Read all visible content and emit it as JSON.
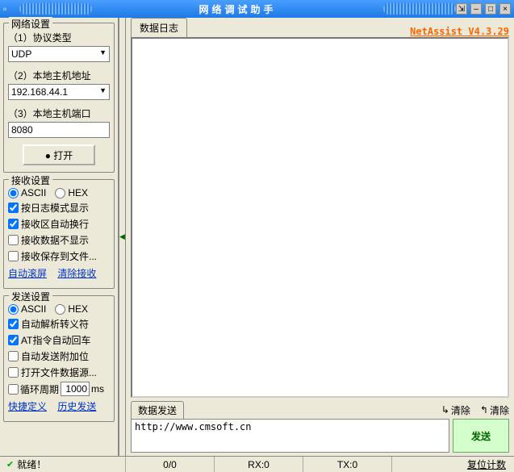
{
  "titlebar": {
    "title": "网络调试助手"
  },
  "version": "NetAssist V4.3.29",
  "sidebar": {
    "net": {
      "title": "网络设置",
      "protocol_label": "（1）协议类型",
      "protocol_value": "UDP",
      "host_label": "（2）本地主机地址",
      "host_value": "192.168.44.1",
      "port_label": "（3）本地主机端口",
      "port_value": "8080",
      "open_btn": "● 打开"
    },
    "recv": {
      "title": "接收设置",
      "ascii": "ASCII",
      "hex": "HEX",
      "opt1": "按日志模式显示",
      "opt2": "接收区自动换行",
      "opt3": "接收数据不显示",
      "opt4": "接收保存到文件...",
      "link1": "自动滚屏",
      "link2": "清除接收"
    },
    "send": {
      "title": "发送设置",
      "ascii": "ASCII",
      "hex": "HEX",
      "opt1": "自动解析转义符",
      "opt2": "AT指令自动回车",
      "opt3": "自动发送附加位",
      "opt4": "打开文件数据源...",
      "loop_label": "循环周期",
      "loop_value": "1000",
      "loop_unit": "ms",
      "link1": "快捷定义",
      "link2": "历史发送"
    }
  },
  "content": {
    "log_tab": "数据日志",
    "send_tab": "数据发送",
    "clear_down": "清除",
    "clear_up": "清除",
    "send_input": "http://www.cmsoft.cn",
    "send_btn": "发送"
  },
  "status": {
    "ready": "就绪！",
    "counter": "0/0",
    "rx": "RX:0",
    "tx": "TX:0",
    "reset": "复位计数"
  }
}
